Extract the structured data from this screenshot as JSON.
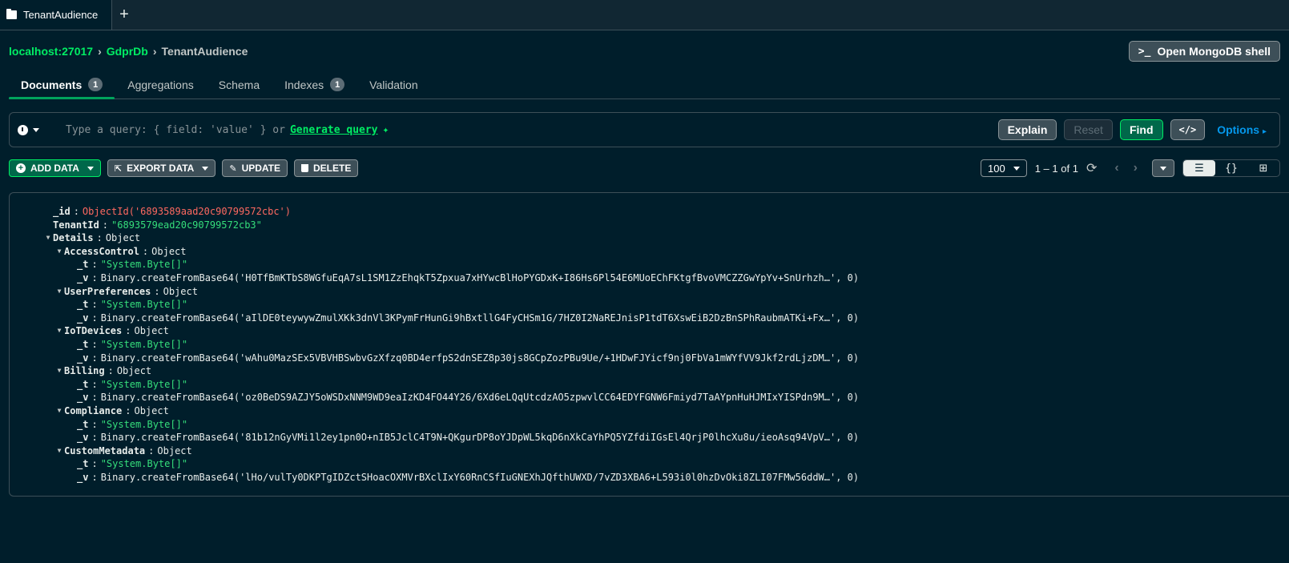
{
  "window_tab": {
    "label": "TenantAudience"
  },
  "breadcrumb": {
    "host": "localhost:27017",
    "db": "GdprDb",
    "collection": "TenantAudience"
  },
  "shell_button": "Open MongoDB shell",
  "tabs": [
    {
      "label": "Documents",
      "badge": "1"
    },
    {
      "label": "Aggregations"
    },
    {
      "label": "Schema"
    },
    {
      "label": "Indexes",
      "badge": "1"
    },
    {
      "label": "Validation"
    }
  ],
  "query": {
    "placeholder": "Type a query: { field: 'value' } or",
    "generate": "Generate query",
    "explain": "Explain",
    "reset": "Reset",
    "find": "Find",
    "code": "</>",
    "options": "Options"
  },
  "toolbar": {
    "add": "ADD DATA",
    "export": "EXPORT DATA",
    "update": "UPDATE",
    "delete": "DELETE",
    "page_size": "100",
    "range": "1 – 1 of 1"
  },
  "document": {
    "id_key": "_id",
    "id_val": "ObjectId('6893589aad20c90799572cbc')",
    "tenant_key": "TenantId",
    "tenant_val": "\"6893579ead20c90799572cb3\"",
    "details_key": "Details",
    "details_val": "Object",
    "fields": [
      {
        "name": "AccessControl",
        "t": "\"System.Byte[]\"",
        "v": "Binary.createFromBase64('H0TfBmKTbS8WGfuEqA7sL1SM1ZzEhqkT5Zpxua7xHYwcBlHoPYGDxK+I86Hs6Pl54E6MUoEChFKtgfBvoVMCZZGwYpYv+SnUrhzh…', 0)"
      },
      {
        "name": "UserPreferences",
        "t": "\"System.Byte[]\"",
        "v": "Binary.createFromBase64('aIlDE0teywywZmulXKk3dnVl3KPymFrHunGi9hBxtllG4FyCHSm1G/7HZ0I2NaREJnisP1tdT6XswEiB2DzBnSPhRaubmATKi+Fx…', 0)"
      },
      {
        "name": "IoTDevices",
        "t": "\"System.Byte[]\"",
        "v": "Binary.createFromBase64('wAhu0MazSEx5VBVHBSwbvGzXfzq0BD4erfpS2dnSEZ8p30js8GCpZozPBu9Ue/+1HDwFJYicf9nj0FbVa1mWYfVV9Jkf2rdLjzDM…', 0)"
      },
      {
        "name": "Billing",
        "t": "\"System.Byte[]\"",
        "v": "Binary.createFromBase64('oz0BeDS9AZJY5oWSDxNNM9WD9eaIzKD4FO44Y26/6Xd6eLQqUtcdzAO5zpwvlCC64EDYFGNW6Fmiyd7TaAYpnHuHJMIxYISPdn9M…', 0)"
      },
      {
        "name": "Compliance",
        "t": "\"System.Byte[]\"",
        "v": "Binary.createFromBase64('81b12nGyVMi1l2ey1pn0O+nIB5JclC4T9N+QKgurDP8oYJDpWL5kqD6nXkCaYhPQ5YZfdiIGsEl4QrjP0lhcXu8u/ieoAsq94VpV…', 0)"
      },
      {
        "name": "CustomMetadata",
        "t": "\"System.Byte[]\"",
        "v": "Binary.createFromBase64('lHo/vulTy0DKPTgIDZctSHoacOXMVrBXclIxY60RnCSfIuGNEXhJQfthUWXD/7vZD3XBA6+L593i0l0hzDvOki8ZLI07FMw56ddW…', 0)"
      }
    ],
    "object_label": "Object",
    "t_key": "_t",
    "v_key": "_v"
  }
}
